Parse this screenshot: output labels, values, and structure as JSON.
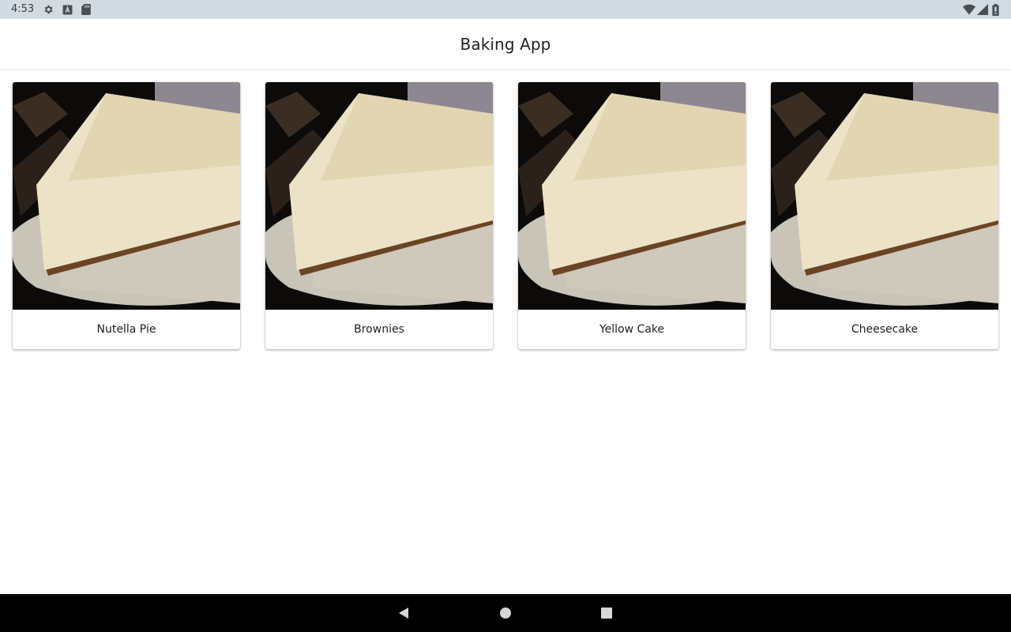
{
  "status_bar": {
    "time": "4:53",
    "left_icons": [
      "gear-icon",
      "a-box-icon",
      "sd-card-icon"
    ],
    "right_icons": [
      "wifi-icon",
      "cell-signal-icon",
      "battery-icon"
    ]
  },
  "app_bar": {
    "title": "Baking App"
  },
  "recipes": [
    {
      "name": "Nutella Pie",
      "image": "cheesecake-slice-photo"
    },
    {
      "name": "Brownies",
      "image": "cheesecake-slice-photo"
    },
    {
      "name": "Yellow Cake",
      "image": "cheesecake-slice-photo"
    },
    {
      "name": "Cheesecake",
      "image": "cheesecake-slice-photo"
    }
  ],
  "nav_bar": {
    "buttons": [
      "back-icon",
      "home-icon",
      "recents-icon"
    ]
  },
  "colors": {
    "status_bar_bg": "#d2dbe2",
    "nav_bar_bg": "#000000",
    "card_bg": "#ffffff"
  }
}
